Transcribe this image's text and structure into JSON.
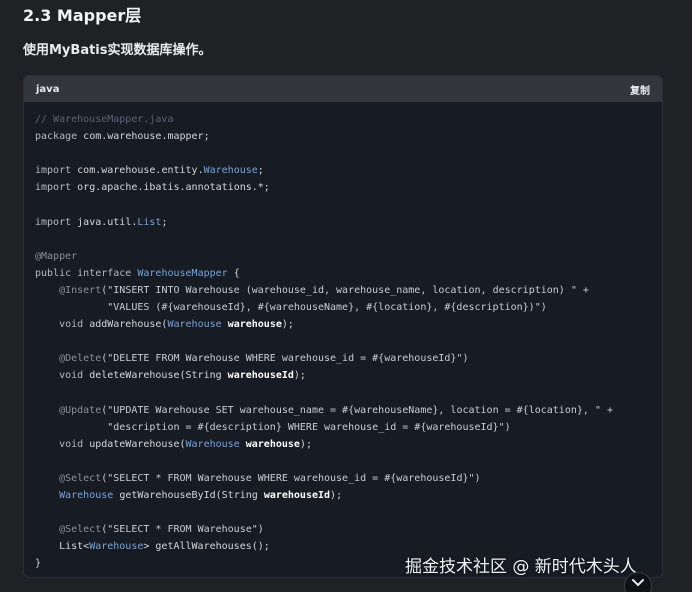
{
  "section": {
    "title": "2.3 Mapper层"
  },
  "description": "使用MyBatis实现数据库操作。",
  "code_block": {
    "language": "java",
    "copy_label": "复制",
    "lines": [
      [
        {
          "t": "// WarehouseMapper.java",
          "s": "comment"
        }
      ],
      [
        {
          "t": "package ",
          "s": "kw"
        },
        {
          "t": "com.warehouse.mapper;",
          "s": "plain"
        }
      ],
      [],
      [
        {
          "t": "import ",
          "s": "kw"
        },
        {
          "t": "com.warehouse.entity.",
          "s": "plain"
        },
        {
          "t": "Warehouse",
          "s": "type"
        },
        {
          "t": ";",
          "s": "plain"
        }
      ],
      [
        {
          "t": "import ",
          "s": "kw"
        },
        {
          "t": "org.apache.ibatis.annotations.*;",
          "s": "plain"
        }
      ],
      [],
      [
        {
          "t": "import ",
          "s": "kw"
        },
        {
          "t": "java.util.",
          "s": "plain"
        },
        {
          "t": "List",
          "s": "type"
        },
        {
          "t": ";",
          "s": "plain"
        }
      ],
      [],
      [
        {
          "t": "@Mapper",
          "s": "ann"
        }
      ],
      [
        {
          "t": "public interface ",
          "s": "kw"
        },
        {
          "t": "WarehouseMapper",
          "s": "type"
        },
        {
          "t": " {",
          "s": "plain"
        }
      ],
      [
        {
          "t": "    @Insert",
          "s": "ann"
        },
        {
          "t": "(\"INSERT INTO Warehouse (warehouse_id, warehouse_name, location, description) \" +",
          "s": "str"
        }
      ],
      [
        {
          "t": "            \"VALUES (#{warehouseId}, #{warehouseName}, #{location}, #{description})\")",
          "s": "str"
        }
      ],
      [
        {
          "t": "    void ",
          "s": "kw"
        },
        {
          "t": "addWarehouse(",
          "s": "plain"
        },
        {
          "t": "Warehouse ",
          "s": "type"
        },
        {
          "t": "warehouse",
          "s": "bold"
        },
        {
          "t": ");",
          "s": "plain"
        }
      ],
      [],
      [
        {
          "t": "    @Delete",
          "s": "ann"
        },
        {
          "t": "(\"DELETE FROM Warehouse WHERE warehouse_id = #{warehouseId}\")",
          "s": "str"
        }
      ],
      [
        {
          "t": "    void ",
          "s": "kw"
        },
        {
          "t": "deleteWarehouse(String ",
          "s": "plain"
        },
        {
          "t": "warehouseId",
          "s": "bold"
        },
        {
          "t": ");",
          "s": "plain"
        }
      ],
      [],
      [
        {
          "t": "    @Update",
          "s": "ann"
        },
        {
          "t": "(\"UPDATE Warehouse SET warehouse_name = #{warehouseName}, location = #{location}, \" +",
          "s": "str"
        }
      ],
      [
        {
          "t": "            \"description = #{description} WHERE warehouse_id = #{warehouseId}\")",
          "s": "str"
        }
      ],
      [
        {
          "t": "    void ",
          "s": "kw"
        },
        {
          "t": "updateWarehouse(",
          "s": "plain"
        },
        {
          "t": "Warehouse ",
          "s": "type"
        },
        {
          "t": "warehouse",
          "s": "bold"
        },
        {
          "t": ");",
          "s": "plain"
        }
      ],
      [],
      [
        {
          "t": "    @Select",
          "s": "ann"
        },
        {
          "t": "(\"SELECT * FROM Warehouse WHERE warehouse_id = #{warehouseId}\")",
          "s": "str"
        }
      ],
      [
        {
          "t": "    ",
          "s": "plain"
        },
        {
          "t": "Warehouse ",
          "s": "type"
        },
        {
          "t": "getWarehouseById(String ",
          "s": "plain"
        },
        {
          "t": "warehouseId",
          "s": "bold"
        },
        {
          "t": ");",
          "s": "plain"
        }
      ],
      [],
      [
        {
          "t": "    @Select",
          "s": "ann"
        },
        {
          "t": "(\"SELECT * FROM Warehouse\")",
          "s": "str"
        }
      ],
      [
        {
          "t": "    List<",
          "s": "plain"
        },
        {
          "t": "Warehouse",
          "s": "type"
        },
        {
          "t": "> getAllWarehouses();",
          "s": "plain"
        }
      ],
      [
        {
          "t": "}",
          "s": "plain"
        }
      ]
    ]
  },
  "watermark": "掘金技术社区 @ 新时代木头人",
  "icons": {
    "scroll_button": "chevron-down-icon"
  }
}
